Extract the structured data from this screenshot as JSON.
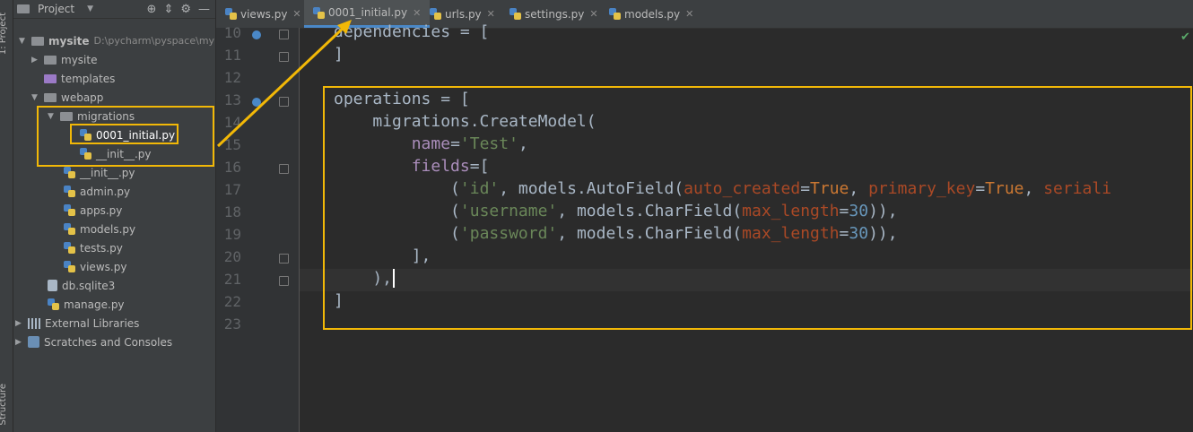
{
  "side_strip": {
    "project_label": "1: Project",
    "structure_label": "Structure"
  },
  "project_panel": {
    "title": "Project",
    "tree": [
      {
        "label": "mysite",
        "path": "D:\\pycharm\\pyspace\\my"
      },
      {
        "label": "mysite"
      },
      {
        "label": "templates"
      },
      {
        "label": "webapp"
      },
      {
        "label": "migrations"
      },
      {
        "label": "0001_initial.py"
      },
      {
        "label": "__init__.py"
      },
      {
        "label": "__init__.py"
      },
      {
        "label": "admin.py"
      },
      {
        "label": "apps.py"
      },
      {
        "label": "models.py"
      },
      {
        "label": "tests.py"
      },
      {
        "label": "views.py"
      },
      {
        "label": "db.sqlite3"
      },
      {
        "label": "manage.py"
      },
      {
        "label": "External Libraries"
      },
      {
        "label": "Scratches and Consoles"
      }
    ]
  },
  "tabs": [
    {
      "label": "views.py"
    },
    {
      "label": "0001_initial.py"
    },
    {
      "label": "urls.py"
    },
    {
      "label": "settings.py"
    },
    {
      "label": "models.py"
    }
  ],
  "editor": {
    "line_numbers": [
      "10",
      "11",
      "12",
      "13",
      "14",
      "15",
      "16",
      "17",
      "18",
      "19",
      "20",
      "21",
      "22",
      "23"
    ],
    "lines": [
      {
        "t": [
          {
            "c": "",
            "v": "dependencies = ["
          }
        ]
      },
      {
        "t": [
          {
            "c": "",
            "v": "]"
          }
        ]
      },
      {
        "t": []
      },
      {
        "t": [
          {
            "c": "",
            "v": "operations = ["
          }
        ]
      },
      {
        "t": [
          {
            "c": "",
            "v": "    migrations.CreateModel("
          }
        ]
      },
      {
        "t": [
          {
            "c": "",
            "v": "        "
          },
          {
            "c": "kwarg",
            "v": "name"
          },
          {
            "c": "",
            "v": "="
          },
          {
            "c": "str",
            "v": "'Test'"
          },
          {
            "c": "",
            "v": ","
          }
        ]
      },
      {
        "t": [
          {
            "c": "",
            "v": "        "
          },
          {
            "c": "kwarg",
            "v": "fields"
          },
          {
            "c": "",
            "v": "=["
          }
        ]
      },
      {
        "t": [
          {
            "c": "",
            "v": "            ("
          },
          {
            "c": "str",
            "v": "'id'"
          },
          {
            "c": "",
            "v": ", models.AutoField("
          },
          {
            "c": "par",
            "v": "auto_created"
          },
          {
            "c": "",
            "v": "="
          },
          {
            "c": "kw",
            "v": "True"
          },
          {
            "c": "",
            "v": ", "
          },
          {
            "c": "par",
            "v": "primary_key"
          },
          {
            "c": "",
            "v": "="
          },
          {
            "c": "kw",
            "v": "True"
          },
          {
            "c": "",
            "v": ", "
          },
          {
            "c": "par",
            "v": "seriali"
          }
        ]
      },
      {
        "t": [
          {
            "c": "",
            "v": "            ("
          },
          {
            "c": "str",
            "v": "'username'"
          },
          {
            "c": "",
            "v": ", models.CharField("
          },
          {
            "c": "par",
            "v": "max_length"
          },
          {
            "c": "",
            "v": "="
          },
          {
            "c": "num",
            "v": "30"
          },
          {
            "c": "",
            "v": ")),"
          }
        ]
      },
      {
        "t": [
          {
            "c": "",
            "v": "            ("
          },
          {
            "c": "str",
            "v": "'password'"
          },
          {
            "c": "",
            "v": ", models.CharField("
          },
          {
            "c": "par",
            "v": "max_length"
          },
          {
            "c": "",
            "v": "="
          },
          {
            "c": "num",
            "v": "30"
          },
          {
            "c": "",
            "v": ")),"
          }
        ]
      },
      {
        "t": [
          {
            "c": "",
            "v": "        ],"
          }
        ]
      },
      {
        "t": [
          {
            "c": "",
            "v": "    ),"
          }
        ]
      },
      {
        "t": [
          {
            "c": "",
            "v": "]"
          }
        ]
      },
      {
        "t": []
      }
    ]
  },
  "colors": {
    "highlight": "#f2b807",
    "keyword": "#cc7832",
    "string": "#6a8759",
    "number": "#6897bb",
    "param": "#aa4926",
    "kwarg": "#aa8dbb"
  }
}
